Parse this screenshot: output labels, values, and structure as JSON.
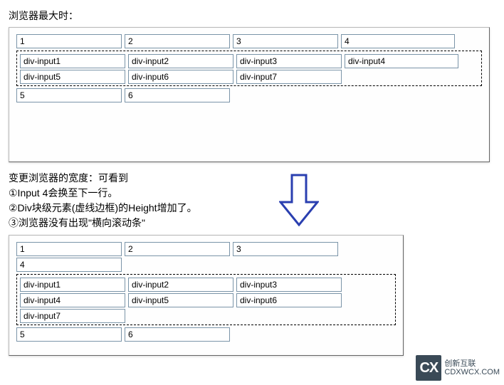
{
  "caption_top": "浏览器最大时：",
  "panel_top": {
    "row1": [
      "1",
      "2",
      "3",
      "4"
    ],
    "div_rows": [
      [
        "div-input1",
        "div-input2",
        "div-input3",
        "div-input4"
      ],
      [
        "div-input5",
        "div-input6",
        "div-input7"
      ]
    ],
    "row_after": [
      "5",
      "6"
    ]
  },
  "notes": {
    "heading": "变更浏览器的宽度：可看到",
    "item1": "①Input 4会换至下一行。",
    "item2": "②Div块级元素(虚线边框)的Height增加了。",
    "item3": "③浏览器没有出现\"横向滚动条\""
  },
  "panel_bottom": {
    "row1": [
      "1",
      "2",
      "3"
    ],
    "row1b": [
      "4"
    ],
    "div_rows": [
      [
        "div-input1",
        "div-input2",
        "div-input3"
      ],
      [
        "div-input4",
        "div-input5",
        "div-input6"
      ],
      [
        "div-input7"
      ]
    ],
    "row_after": [
      "5",
      "6"
    ]
  },
  "logo": {
    "mark": "CX",
    "line1": "创新互联",
    "line2": "CDXWCX.COM"
  }
}
